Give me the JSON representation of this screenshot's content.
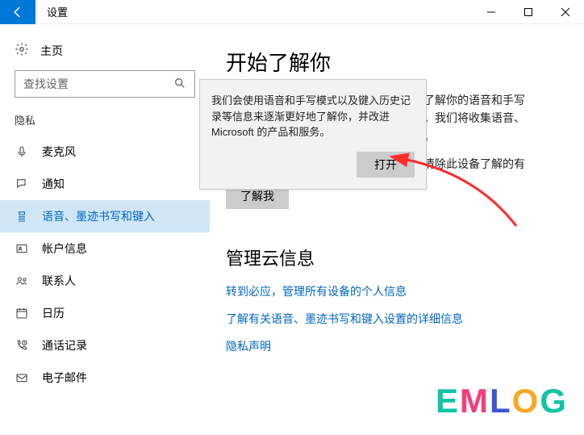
{
  "window": {
    "title": "设置"
  },
  "sidebar": {
    "home": "主页",
    "search_placeholder": "查找设置",
    "group": "隐私",
    "items": [
      {
        "icon": "mic",
        "label": "麦克风"
      },
      {
        "icon": "bell",
        "label": "通知"
      },
      {
        "icon": "speech",
        "label": "语音、墨迹书写和键入"
      },
      {
        "icon": "account",
        "label": "帐户信息"
      },
      {
        "icon": "contacts",
        "label": "联系人"
      },
      {
        "icon": "calendar",
        "label": "日历"
      },
      {
        "icon": "callhist",
        "label": "通话记录"
      },
      {
        "icon": "mail",
        "label": "电子邮件"
      }
    ]
  },
  "content": {
    "heading1": "开始了解你",
    "para1a": "步了解你的语音和手写",
    "para1b": "议。我们将收集语音、",
    "para1c": "息。",
    "para2": "并清除此设备了解的有",
    "know_me_btn": "了解我",
    "heading2": "管理云信息",
    "link1": "转到必应，管理所有设备的个人信息",
    "link2": "了解有关语音、墨迹书写和键入设置的详细信息",
    "link3": "隐私声明"
  },
  "tooltip": {
    "text": "我们会使用语音和手写模式以及键入历史记录等信息来逐渐更好地了解你，并改进 Microsoft 的产品和服务。",
    "button": "打开"
  },
  "watermark": "EMLOG"
}
